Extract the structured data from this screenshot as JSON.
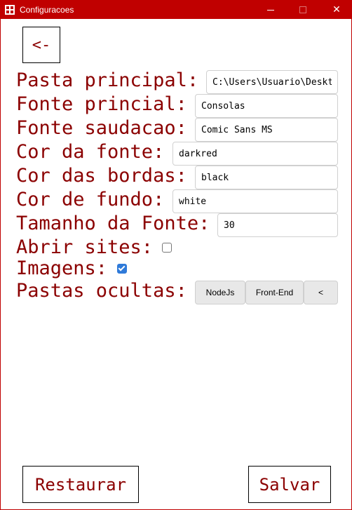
{
  "window": {
    "title": "Configuracoes",
    "minimize_icon": "minimize-icon",
    "maximize_icon": "maximize-icon",
    "close_icon": "close-icon",
    "close_glyph": "✕",
    "title_color": "#c00000"
  },
  "back_button": {
    "label": "<-"
  },
  "form": {
    "main_folder": {
      "label": "Pasta principal:",
      "value": "C:\\Users\\Usuario\\Desktop"
    },
    "main_font": {
      "label": "Fonte princial:",
      "value": "Consolas"
    },
    "greeting_font": {
      "label": "Fonte saudacao:",
      "value": "Comic Sans MS"
    },
    "font_color": {
      "label": "Cor da fonte:",
      "value": "darkred"
    },
    "border_color": {
      "label": "Cor das bordas:",
      "value": "black"
    },
    "background_color": {
      "label": "Cor de fundo:",
      "value": "white"
    },
    "font_size": {
      "label": "Tamanho da Fonte:",
      "value": "30"
    },
    "open_sites": {
      "label": "Abrir sites:",
      "checked": false
    },
    "images": {
      "label": "Imagens:",
      "checked": true
    },
    "hidden_folders": {
      "label": "Pastas ocultas:",
      "items": [
        "NodeJs",
        "Front-End"
      ],
      "scroll_label": "<"
    }
  },
  "actions": {
    "restore_label": "Restaurar",
    "save_label": "Salvar"
  },
  "colors": {
    "accent": "#c00000",
    "text": "#8b0000",
    "checkbox_checked": "#2f7ad9"
  }
}
